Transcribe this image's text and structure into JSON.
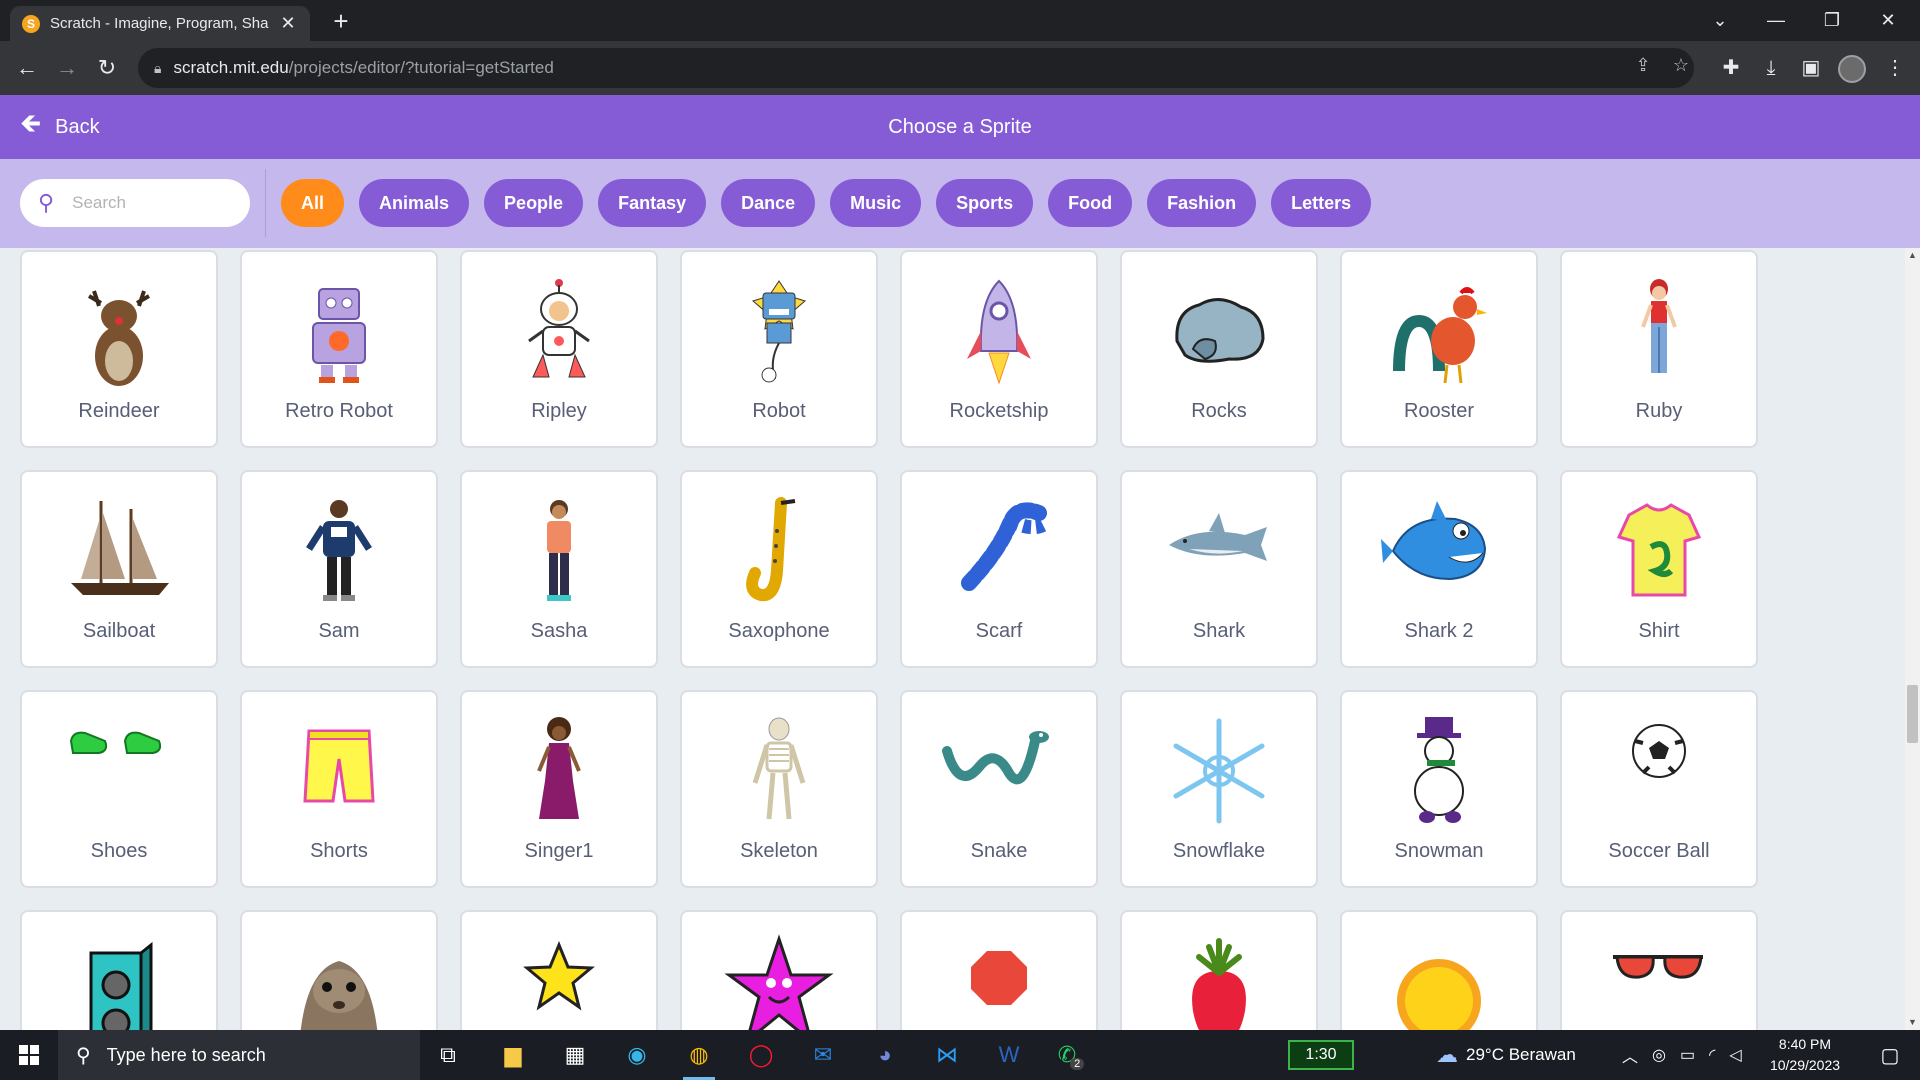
{
  "browser": {
    "tab_title": "Scratch - Imagine, Program, Sha",
    "url_host": "scratch.mit.edu",
    "url_path": "/projects/editor/?tutorial=getStarted"
  },
  "header": {
    "back_label": "Back",
    "title": "Choose a Sprite"
  },
  "search": {
    "placeholder": "Search"
  },
  "categories": [
    "All",
    "Animals",
    "People",
    "Fantasy",
    "Dance",
    "Music",
    "Sports",
    "Food",
    "Fashion",
    "Letters"
  ],
  "active_category": "All",
  "sprites": [
    {
      "name": "Reindeer",
      "icon": "reindeer"
    },
    {
      "name": "Retro Robot",
      "icon": "retro-robot"
    },
    {
      "name": "Ripley",
      "icon": "ripley"
    },
    {
      "name": "Robot",
      "icon": "robot"
    },
    {
      "name": "Rocketship",
      "icon": "rocketship"
    },
    {
      "name": "Rocks",
      "icon": "rocks"
    },
    {
      "name": "Rooster",
      "icon": "rooster"
    },
    {
      "name": "Ruby",
      "icon": "ruby"
    },
    {
      "name": "Sailboat",
      "icon": "sailboat"
    },
    {
      "name": "Sam",
      "icon": "sam"
    },
    {
      "name": "Sasha",
      "icon": "sasha"
    },
    {
      "name": "Saxophone",
      "icon": "saxophone"
    },
    {
      "name": "Scarf",
      "icon": "scarf"
    },
    {
      "name": "Shark",
      "icon": "shark"
    },
    {
      "name": "Shark 2",
      "icon": "shark2"
    },
    {
      "name": "Shirt",
      "icon": "shirt"
    },
    {
      "name": "Shoes",
      "icon": "shoes"
    },
    {
      "name": "Shorts",
      "icon": "shorts"
    },
    {
      "name": "Singer1",
      "icon": "singer"
    },
    {
      "name": "Skeleton",
      "icon": "skeleton"
    },
    {
      "name": "Snake",
      "icon": "snake"
    },
    {
      "name": "Snowflake",
      "icon": "snowflake"
    },
    {
      "name": "Snowman",
      "icon": "snowman"
    },
    {
      "name": "Soccer Ball",
      "icon": "soccer-ball"
    },
    {
      "name": "",
      "icon": "speaker"
    },
    {
      "name": "",
      "icon": "squirrel"
    },
    {
      "name": "",
      "icon": "star"
    },
    {
      "name": "",
      "icon": "starfish"
    },
    {
      "name": "",
      "icon": "stop-sign"
    },
    {
      "name": "",
      "icon": "strawberry"
    },
    {
      "name": "",
      "icon": "sun"
    },
    {
      "name": "",
      "icon": "sunglasses"
    }
  ],
  "taskbar": {
    "search_placeholder": "Type here to search",
    "timer": "1:30",
    "weather": "29°C  Berawan",
    "time": "8:40 PM",
    "date": "10/29/2023",
    "whatsapp_badge": "2"
  },
  "colors": {
    "header_purple": "#855cd6",
    "filter_bar": "#c5b8ec",
    "active_chip": "#ff8c1a",
    "label_text": "#575e75"
  }
}
